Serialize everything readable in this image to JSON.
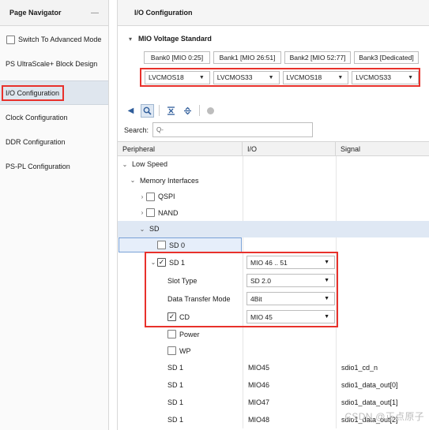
{
  "navigator": {
    "title": "Page Navigator",
    "minimize_icon": "minimize-icon",
    "advanced_mode_label": "Switch To Advanced Mode",
    "items": [
      {
        "label": "PS UltraScale+ Block Design"
      },
      {
        "label": "I/O Configuration"
      },
      {
        "label": "Clock Configuration"
      },
      {
        "label": "DDR Configuration"
      },
      {
        "label": "PS-PL Configuration"
      }
    ]
  },
  "main": {
    "title": "I/O Configuration",
    "mio_section": {
      "title": "MIO Voltage Standard",
      "banks": [
        "Bank0 [MIO 0:25]",
        "Bank1 [MIO 26:51]",
        "Bank2 [MIO 52:77]",
        "Bank3 [Dedicated]"
      ],
      "voltages": [
        "LVCMOS18",
        "LVCMOS33",
        "LVCMOS18",
        "LVCMOS33"
      ]
    },
    "toolbar": {
      "icons": [
        "back-arrow-icon",
        "search-icon",
        "collapse-all-icon",
        "expand-all-icon",
        "status-dot-icon"
      ]
    },
    "search": {
      "label": "Search:",
      "placeholder": "Q-"
    },
    "table": {
      "headers": [
        "Peripheral",
        "I/O",
        "Signal"
      ],
      "rows": {
        "low_speed": "Low Speed",
        "memory_interfaces": "Memory Interfaces",
        "qspi": "QSPI",
        "nand": "NAND",
        "sd": "SD",
        "sd0": "SD 0",
        "sd1": "SD 1",
        "sd1_io": "MIO 46 .. 51",
        "slot_type_label": "Slot Type",
        "slot_type_value": "SD 2.0",
        "data_mode_label": "Data Transfer Mode",
        "data_mode_value": "4Bit",
        "cd_label": "CD",
        "cd_value": "MIO 45",
        "power_label": "Power",
        "wp_label": "WP",
        "signals": [
          {
            "peripheral": "SD 1",
            "io": "MIO45",
            "signal": "sdio1_cd_n"
          },
          {
            "peripheral": "SD 1",
            "io": "MIO46",
            "signal": "sdio1_data_out[0]"
          },
          {
            "peripheral": "SD 1",
            "io": "MIO47",
            "signal": "sdio1_data_out[1]"
          },
          {
            "peripheral": "SD 1",
            "io": "MIO48",
            "signal": "sdio1_data_out[2]"
          }
        ]
      }
    }
  },
  "watermark": "CSDN @正点原子",
  "colors": {
    "highlight": "#e8312b",
    "selection": "#dfe8f4",
    "accent": "#2f5d9a"
  }
}
